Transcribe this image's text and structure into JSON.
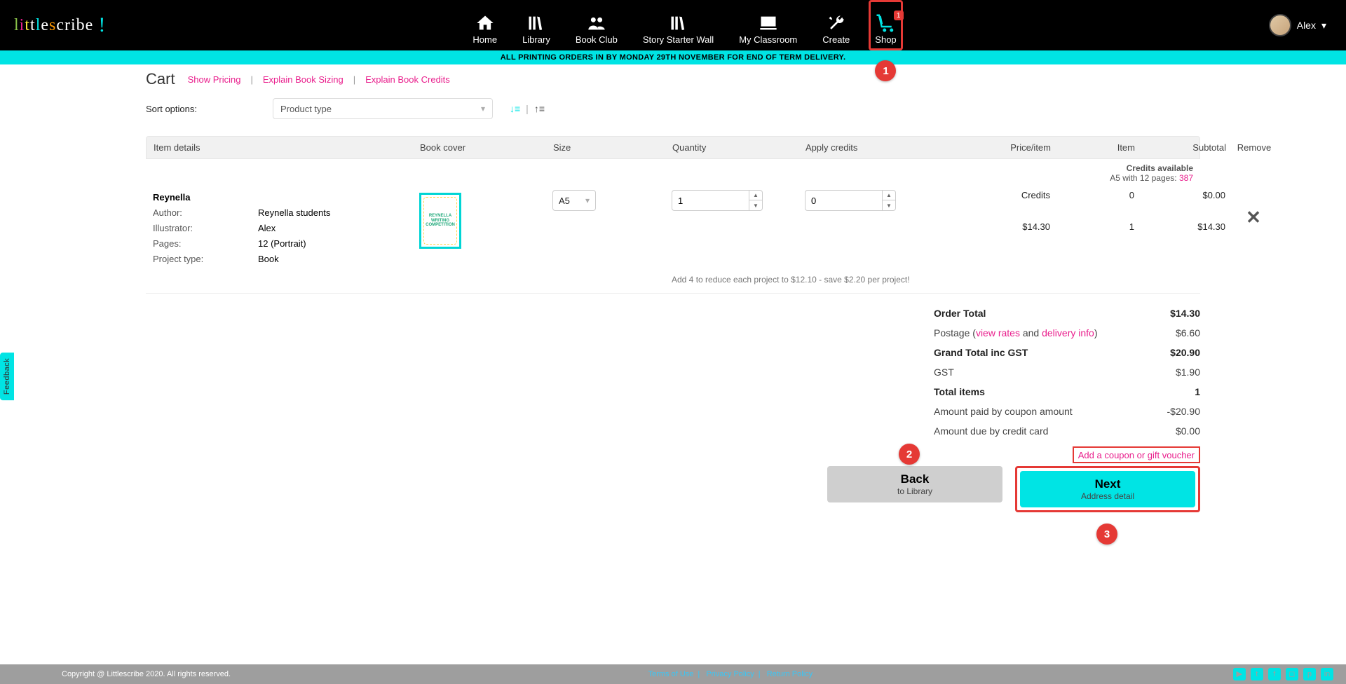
{
  "brand": {
    "letters": [
      "l",
      "i",
      "t",
      "t",
      "l",
      "e",
      "s",
      "cribe "
    ],
    "exclaim": "!"
  },
  "banner": "ALL PRINTING ORDERS IN BY MONDAY 29TH NOVEMBER FOR END OF TERM DELIVERY.",
  "nav": {
    "items": [
      {
        "label": "Home",
        "icon": "home"
      },
      {
        "label": "Library",
        "icon": "books"
      },
      {
        "label": "Book Club",
        "icon": "users"
      },
      {
        "label": "Story Starter Wall",
        "icon": "books"
      },
      {
        "label": "My Classroom",
        "icon": "chalkboard"
      },
      {
        "label": "Create",
        "icon": "wrench"
      },
      {
        "label": "Shop",
        "icon": "cart",
        "badge": "1",
        "active": true
      }
    ],
    "user": {
      "name": "Alex"
    }
  },
  "cart": {
    "title": "Cart",
    "links": {
      "pricing": "Show Pricing",
      "sizing": "Explain Book Sizing",
      "credits": "Explain Book Credits"
    },
    "sort": {
      "label": "Sort options:",
      "value": "Product type"
    },
    "columns": [
      "Item details",
      "Book cover",
      "Size",
      "Quantity",
      "Apply credits",
      "Price/item",
      "Item",
      "Subtotal",
      "Remove"
    ],
    "credits_available": {
      "label": "Credits available",
      "detail_prefix": "A5 with 12 pages: ",
      "detail_count": "387"
    },
    "item": {
      "title": "Reynella",
      "author_label": "Author:",
      "author": "Reynella students",
      "illus_label": "Illustrator:",
      "illus": "Alex",
      "pages_label": "Pages:",
      "pages": "12 (Portrait)",
      "ptype_label": "Project type:",
      "ptype": "Book",
      "cover_text": "REYNELLA WRITING COMPETITION",
      "size": "A5",
      "quantity": "1",
      "credits_apply": "0",
      "promo": "Add 4 to reduce each project to $12.10 - save $2.20 per project!",
      "credits_row_label": "Credits",
      "credits_row_item": "0",
      "credits_row_sub": "$0.00",
      "price": "$14.30",
      "item_count": "1",
      "subtotal": "$14.30"
    },
    "totals": {
      "order_label": "Order Total",
      "order_value": "$14.30",
      "postage_prefix": "Postage (",
      "postage_rates": "view rates",
      "postage_and": " and ",
      "postage_info": "delivery info",
      "postage_suffix": ")",
      "postage_value": "$6.60",
      "grand_label": "Grand Total inc GST",
      "grand_value": "$20.90",
      "gst_label": "GST",
      "gst_value": "$1.90",
      "items_label": "Total items",
      "items_value": "1",
      "coupon_label": "Amount paid by coupon amount",
      "coupon_value": "-$20.90",
      "cc_label": "Amount due by credit card",
      "cc_value": "$0.00",
      "add_coupon": "Add a coupon or gift voucher"
    },
    "buttons": {
      "back_main": "Back",
      "back_sub": "to Library",
      "next_main": "Next",
      "next_sub": "Address detail"
    }
  },
  "callouts": {
    "one": "1",
    "two": "2",
    "three": "3"
  },
  "footer": {
    "copyright": "Copyright @ Littlescribe 2020. All rights reserved.",
    "links": [
      "Terms of Use",
      "Privacy Policy",
      "Return Policy"
    ]
  },
  "feedback": "Feedback"
}
